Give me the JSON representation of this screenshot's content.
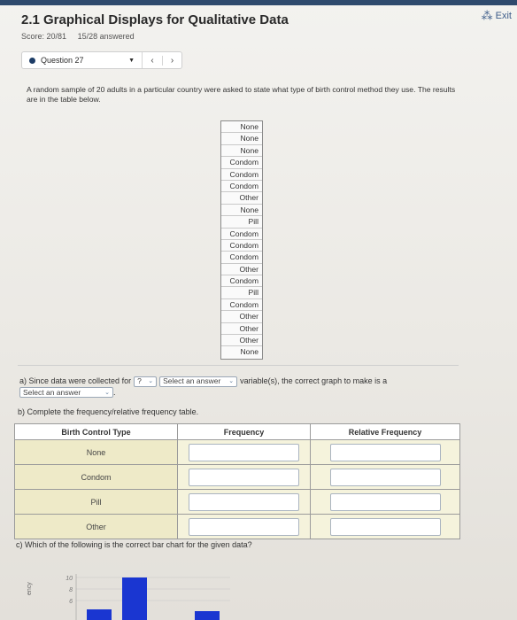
{
  "header": {
    "title": "2.1 Graphical Displays for Qualitative Data",
    "score": "Score: 20/81",
    "answered": "15/28 answered",
    "exit_label": "Exit"
  },
  "question_nav": {
    "current": "Question 27",
    "prev_icon": "chevron-left-icon",
    "next_icon": "chevron-right-icon"
  },
  "prompt": "A random sample of 20 adults in a particular country were asked to state what type of birth control method they use. The results are in the table below.",
  "raw_data": [
    "None",
    "None",
    "None",
    "Condom",
    "Condom",
    "Condom",
    "Other",
    "None",
    "Pill",
    "Condom",
    "Condom",
    "Condom",
    "Other",
    "Condom",
    "Pill",
    "Condom",
    "Other",
    "Other",
    "Other",
    "None"
  ],
  "part_a": {
    "text_before": "a) Since data were collected for",
    "q_select": "?",
    "var_select": "Select an answer",
    "text_after": "variable(s), the correct graph to make is a",
    "graph_select": "Select an answer"
  },
  "part_b": {
    "text": "b) Complete the frequency/relative frequency table.",
    "headers": [
      "Birth Control Type",
      "Frequency",
      "Relative Frequency"
    ],
    "rows": [
      "None",
      "Condom",
      "Pill",
      "Other"
    ]
  },
  "part_c": {
    "text": "c) Which of the following is the correct bar chart for the given data?"
  },
  "chart_data": {
    "type": "bar",
    "y_ticks": [
      "10",
      "8",
      "6"
    ],
    "ylabel": "ency",
    "colors": [
      "#1a36d1"
    ]
  }
}
